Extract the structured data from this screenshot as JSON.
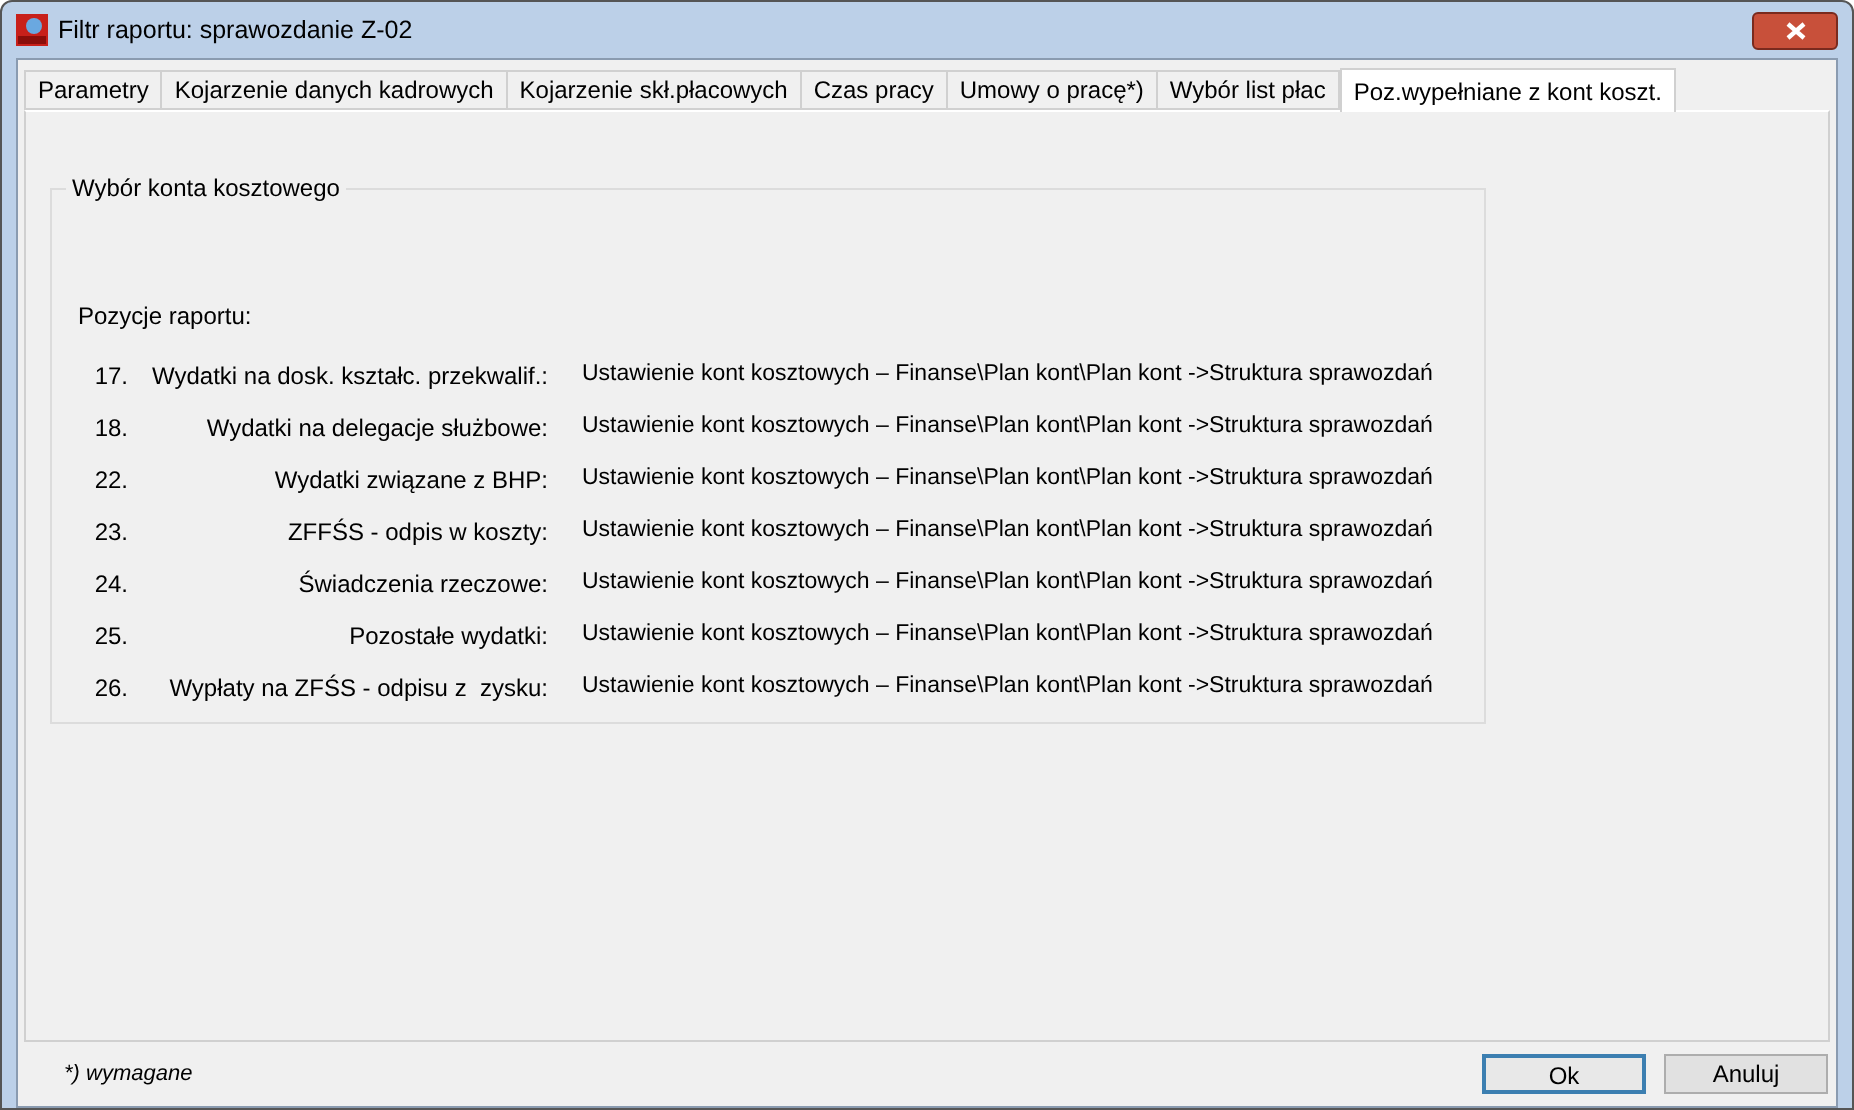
{
  "window": {
    "title": "Filtr raportu: sprawozdanie Z-02"
  },
  "tabs": [
    {
      "label": "Parametry",
      "selected": false
    },
    {
      "label": "Kojarzenie danych kadrowych",
      "selected": false
    },
    {
      "label": "Kojarzenie skł.płacowych",
      "selected": false
    },
    {
      "label": "Czas pracy",
      "selected": false
    },
    {
      "label": "Umowy o pracę*)",
      "selected": false
    },
    {
      "label": "Wybór list płac",
      "selected": false
    },
    {
      "label": "Poz.wypełniane z kont koszt.",
      "selected": true
    }
  ],
  "group": {
    "title": "Wybór konta kosztowego",
    "section_label": "Pozycje raportu:",
    "rows": [
      {
        "number": "17.",
        "label": "Wydatki na dosk. kształc. przekwalif.:",
        "value": "Ustawienie kont kosztowych – Finanse\\Plan kont\\Plan kont ->Struktura sprawozdań"
      },
      {
        "number": "18.",
        "label": "Wydatki na delegacje służbowe:",
        "value": "Ustawienie kont kosztowych – Finanse\\Plan kont\\Plan kont ->Struktura sprawozdań"
      },
      {
        "number": "22.",
        "label": "Wydatki związane z BHP:",
        "value": "Ustawienie kont kosztowych – Finanse\\Plan kont\\Plan kont ->Struktura sprawozdań"
      },
      {
        "number": "23.",
        "label": "ZFFŚS - odpis w koszty:",
        "value": "Ustawienie kont kosztowych – Finanse\\Plan kont\\Plan kont ->Struktura sprawozdań"
      },
      {
        "number": "24.",
        "label": "Świadczenia rzeczowe:",
        "value": "Ustawienie kont kosztowych – Finanse\\Plan kont\\Plan kont ->Struktura sprawozdań"
      },
      {
        "number": "25.",
        "label": "Pozostałe wydatki:",
        "value": "Ustawienie kont kosztowych – Finanse\\Plan kont\\Plan kont ->Struktura sprawozdań"
      },
      {
        "number": "26.",
        "label": "Wypłaty na ZFŚS - odpisu z  zysku:",
        "value": "Ustawienie kont kosztowych – Finanse\\Plan kont\\Plan kont ->Struktura sprawozdań"
      }
    ]
  },
  "footer_note": "*) wymagane",
  "buttons": [
    {
      "label": "Ok",
      "default": true
    },
    {
      "label": "Anuluj",
      "default": false
    }
  ]
}
